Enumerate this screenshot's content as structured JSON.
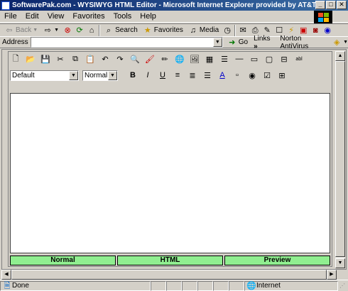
{
  "window": {
    "title": "SoftwarePak.com - WYSIWYG HTML Editor - Microsoft Internet Explorer provided by AT&T Broad...",
    "minimize": "_",
    "maximize": "□",
    "close": "✕"
  },
  "menu": {
    "items": [
      "File",
      "Edit",
      "View",
      "Favorites",
      "Tools",
      "Help"
    ]
  },
  "toolbar": {
    "back": "Back",
    "forward": "",
    "search": "Search",
    "favorites": "Favorites",
    "media": "Media"
  },
  "address": {
    "label": "Address",
    "value": "",
    "go": "Go",
    "links": "Links",
    "links_chevron": "»",
    "norton": "Norton AntiVirus"
  },
  "editor": {
    "font_select": "Default",
    "style_select": "Normal",
    "format_bold": "B",
    "format_italic": "I",
    "format_underline": "U",
    "tabs": [
      "Normal",
      "HTML",
      "Preview"
    ]
  },
  "status": {
    "text": "Done",
    "zone": "Internet"
  },
  "colors": {
    "tab_green": "#90ee90",
    "title_blue": "#0a246a"
  }
}
